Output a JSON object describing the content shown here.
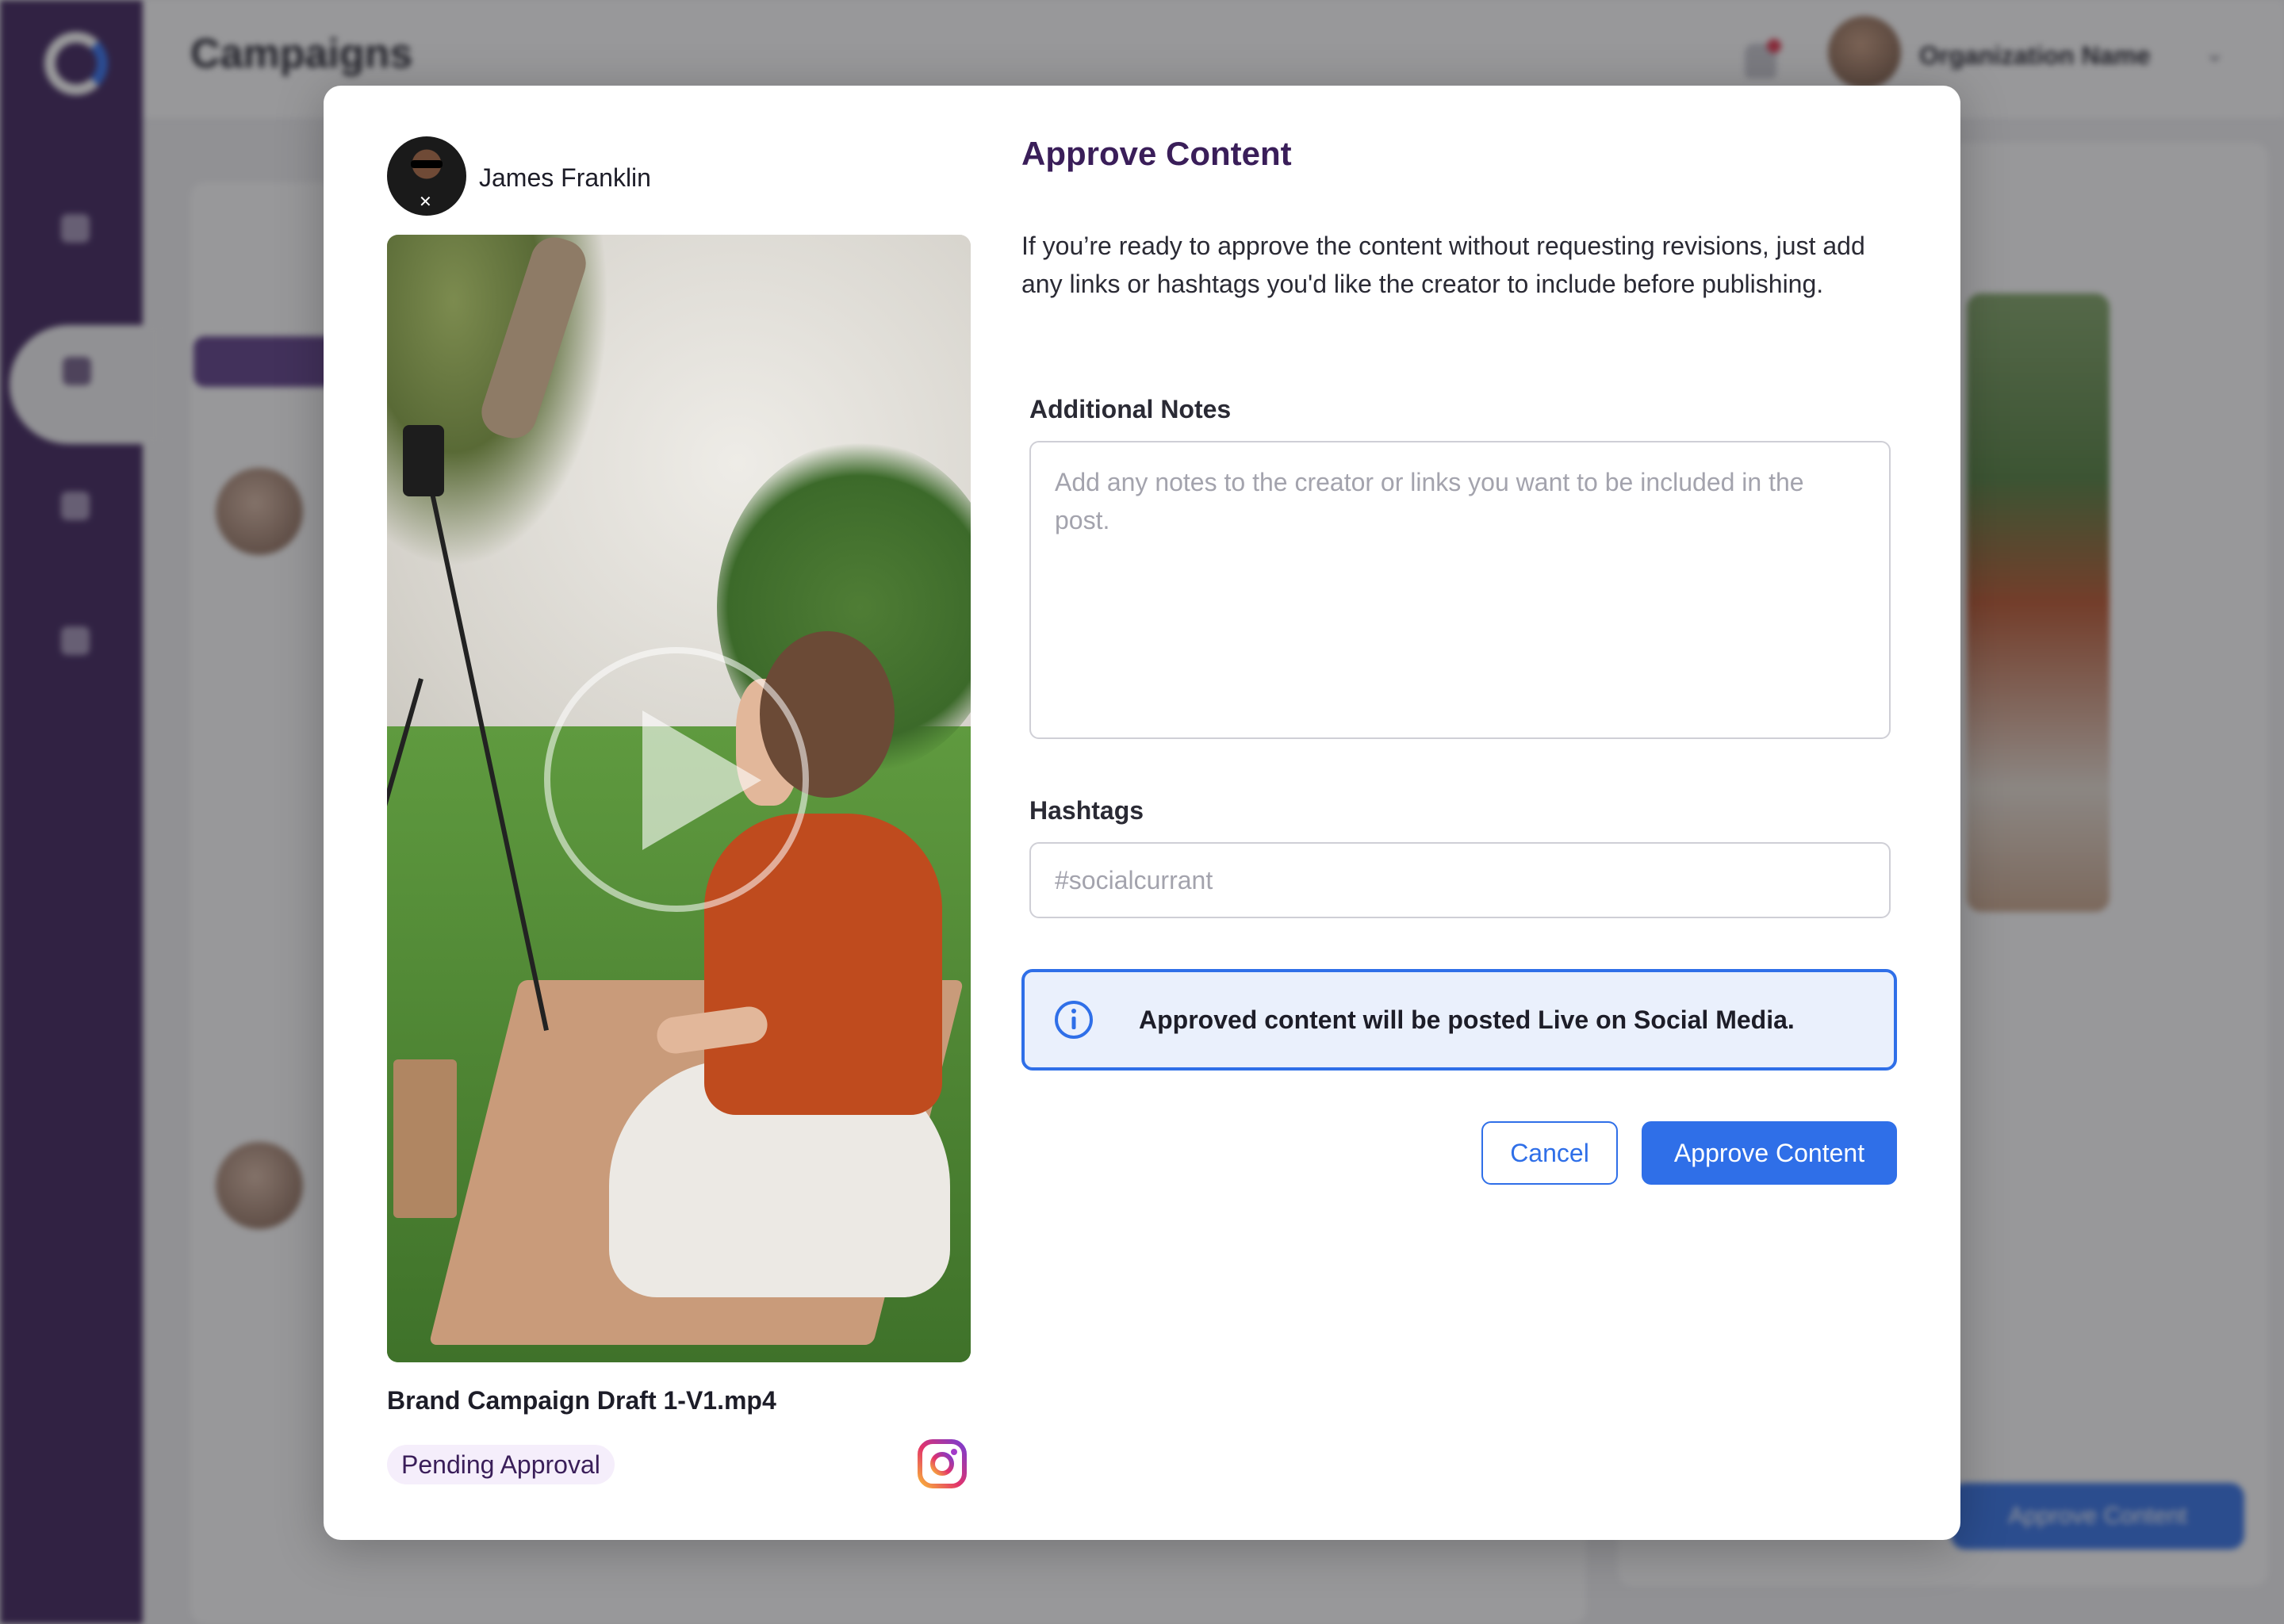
{
  "background": {
    "page_title": "Campaigns",
    "org_name": "Organization Name",
    "approve_button_label": "Approve Content"
  },
  "modal": {
    "creator": {
      "name": "James Franklin"
    },
    "media": {
      "file_name": "Brand Campaign Draft 1-V1.mp4",
      "status": "Pending Approval",
      "platform_icon": "instagram-icon"
    },
    "title": "Approve Content",
    "description": "If you’re ready to approve the content without requesting revisions, just add any links or hashtags you'd like the creator to include before publishing.",
    "notes": {
      "label": "Additional Notes",
      "value": "",
      "placeholder": "Add any notes to the creator or links you want to be included in the post."
    },
    "hashtags": {
      "label": "Hashtags",
      "value": "",
      "placeholder": "#socialcurrant"
    },
    "info_banner": {
      "icon": "info-icon",
      "text": "Approved content will be posted Live on Social Media."
    },
    "buttons": {
      "cancel": "Cancel",
      "approve": "Approve Content"
    }
  },
  "colors": {
    "brand_purple": "#3a1e59",
    "primary_blue": "#2f6fe8",
    "info_bg": "#eaf0fc",
    "badge_bg": "#f5eefb"
  }
}
